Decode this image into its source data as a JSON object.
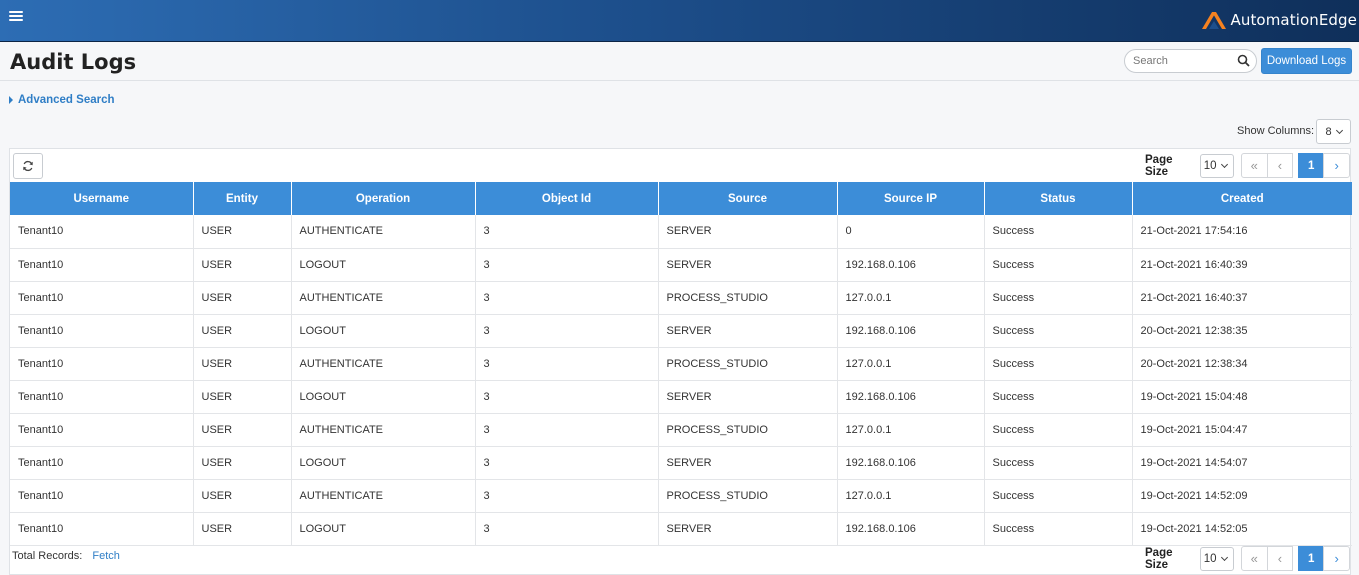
{
  "app": {
    "logo_text": "AutomationEdge",
    "brand_color": "#3c8dd8",
    "logo_accent": "#f58220"
  },
  "header": {
    "menu_icon": "hamburger-icon"
  },
  "page": {
    "title": "Audit Logs",
    "search_placeholder": "Search",
    "download_label": "Download Logs",
    "advanced_search_label": "Advanced Search",
    "show_columns_label": "Show Columns:",
    "show_columns_value": "8"
  },
  "pager_top": {
    "page_size_label": "Page Size",
    "page_size_value": "10",
    "current_page": "1"
  },
  "pager_bottom": {
    "page_size_label": "Page Size",
    "page_size_value": "10",
    "current_page": "1"
  },
  "table": {
    "columns": [
      "Username",
      "Entity",
      "Operation",
      "Object Id",
      "Source",
      "Source IP",
      "Status",
      "Created"
    ],
    "rows": [
      [
        "Tenant10",
        "USER",
        "AUTHENTICATE",
        "3",
        "SERVER",
        "0",
        "Success",
        "21-Oct-2021 17:54:16"
      ],
      [
        "Tenant10",
        "USER",
        "LOGOUT",
        "3",
        "SERVER",
        "192.168.0.106",
        "Success",
        "21-Oct-2021 16:40:39"
      ],
      [
        "Tenant10",
        "USER",
        "AUTHENTICATE",
        "3",
        "PROCESS_STUDIO",
        "127.0.0.1",
        "Success",
        "21-Oct-2021 16:40:37"
      ],
      [
        "Tenant10",
        "USER",
        "LOGOUT",
        "3",
        "SERVER",
        "192.168.0.106",
        "Success",
        "20-Oct-2021 12:38:35"
      ],
      [
        "Tenant10",
        "USER",
        "AUTHENTICATE",
        "3",
        "PROCESS_STUDIO",
        "127.0.0.1",
        "Success",
        "20-Oct-2021 12:38:34"
      ],
      [
        "Tenant10",
        "USER",
        "LOGOUT",
        "3",
        "SERVER",
        "192.168.0.106",
        "Success",
        "19-Oct-2021 15:04:48"
      ],
      [
        "Tenant10",
        "USER",
        "AUTHENTICATE",
        "3",
        "PROCESS_STUDIO",
        "127.0.0.1",
        "Success",
        "19-Oct-2021 15:04:47"
      ],
      [
        "Tenant10",
        "USER",
        "LOGOUT",
        "3",
        "SERVER",
        "192.168.0.106",
        "Success",
        "19-Oct-2021 14:54:07"
      ],
      [
        "Tenant10",
        "USER",
        "AUTHENTICATE",
        "3",
        "PROCESS_STUDIO",
        "127.0.0.1",
        "Success",
        "19-Oct-2021 14:52:09"
      ],
      [
        "Tenant10",
        "USER",
        "LOGOUT",
        "3",
        "SERVER",
        "192.168.0.106",
        "Success",
        "19-Oct-2021 14:52:05"
      ]
    ]
  },
  "footer": {
    "total_records_label": "Total Records:",
    "fetch_label": "Fetch"
  }
}
